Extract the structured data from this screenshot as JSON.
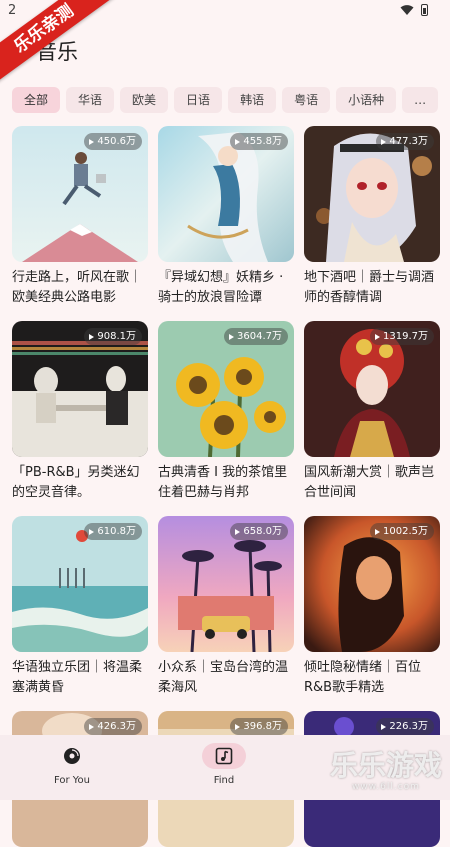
{
  "status_bar": {
    "time": "2"
  },
  "watermark": {
    "ribbon": "乐乐亲测",
    "corner": "乐乐游戏",
    "corner_url": "www.6ll.com"
  },
  "header": {
    "title": "音乐"
  },
  "tabs": [
    "全部",
    "华语",
    "欧美",
    "日语",
    "韩语",
    "粤语",
    "小语种",
    "…"
  ],
  "playlists": [
    {
      "count": "450.6万",
      "title": "行走路上，听风在歌｜欧美经典公路电影"
    },
    {
      "count": "455.8万",
      "title": "『异域幻想』妖精乡 · 骑士的放浪冒险谭"
    },
    {
      "count": "477.3万",
      "title": "地下酒吧｜爵士与调酒师的香醇情调"
    },
    {
      "count": "908.1万",
      "title": "「PB-R&B」另类迷幻的空灵音律。"
    },
    {
      "count": "3604.7万",
      "title": "古典清香 I 我的茶馆里住着巴赫与肖邦"
    },
    {
      "count": "1319.7万",
      "title": "国风新潮大赏｜歌声岂合世间闻"
    },
    {
      "count": "610.8万",
      "title": "华语独立乐团｜将温柔塞满黄昏"
    },
    {
      "count": "658.0万",
      "title": "小众系｜宝岛台湾的温柔海风"
    },
    {
      "count": "1002.5万",
      "title": "倾吐隐秘情绪｜百位R&B歌手精选"
    },
    {
      "count": "426.3万",
      "title": ""
    },
    {
      "count": "396.8万",
      "title": ""
    },
    {
      "count": "226.3万",
      "title": ""
    }
  ],
  "bottom_nav": [
    {
      "label": "For You",
      "icon": "disc-icon",
      "active": false
    },
    {
      "label": "Find",
      "icon": "music-note-icon",
      "active": true
    }
  ]
}
